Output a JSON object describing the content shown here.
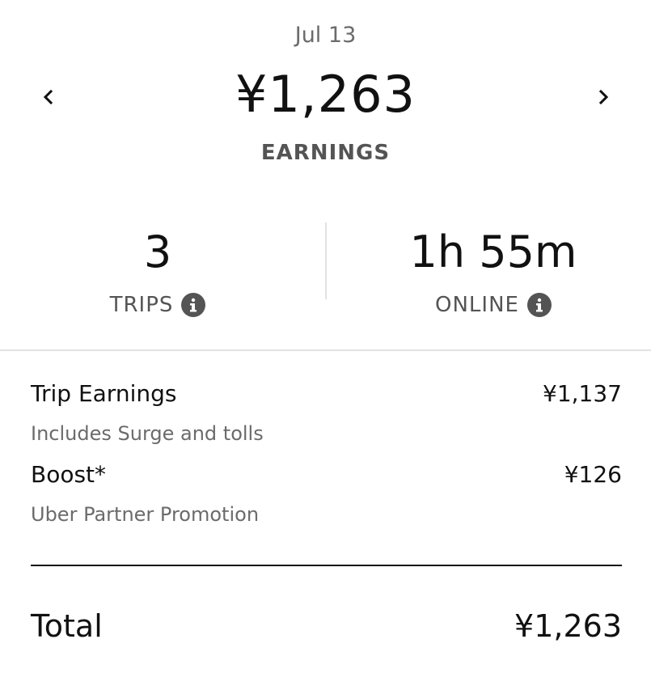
{
  "header": {
    "date": "Jul 13",
    "amount": "¥1,263",
    "label": "EARNINGS",
    "prev_icon": "chevron-left-icon",
    "next_icon": "chevron-right-icon"
  },
  "stats": {
    "trips": {
      "value": "3",
      "label": "TRIPS",
      "icon": "info-icon"
    },
    "online": {
      "value": "1h 55m",
      "label": "ONLINE",
      "icon": "info-icon"
    }
  },
  "breakdown": [
    {
      "title": "Trip Earnings",
      "value": "¥1,137",
      "subtitle": "Includes Surge and tolls"
    },
    {
      "title": "Boost*",
      "value": "¥126",
      "subtitle": "Uber Partner Promotion"
    }
  ],
  "total": {
    "label": "Total",
    "value": "¥1,263"
  },
  "colors": {
    "text": "#111111",
    "muted": "#6b6b6b",
    "label": "#545454",
    "divider": "#e2e2e2"
  }
}
